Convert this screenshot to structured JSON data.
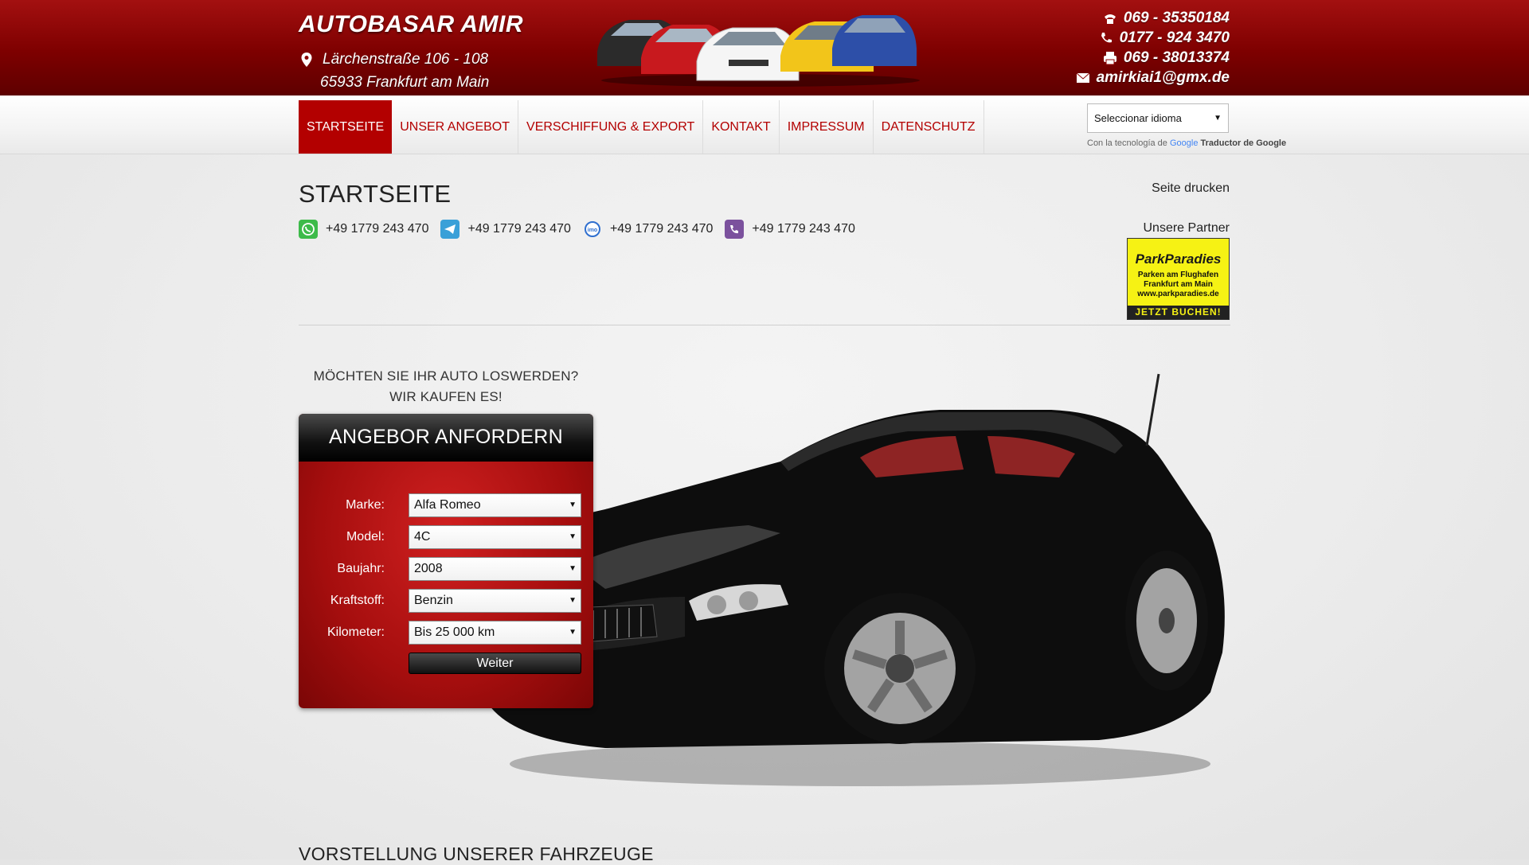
{
  "header": {
    "brand": "AUTOBASAR AMIR",
    "address_line1": "Lärchenstraße 106 - 108",
    "address_line2": "65933 Frankfurt am Main",
    "contacts": [
      {
        "icon": "phone-icon",
        "text": "069 - 35350184"
      },
      {
        "icon": "mobile-icon",
        "text": "0177 - 924 3470"
      },
      {
        "icon": "fax-icon",
        "text": "069 - 38013374"
      },
      {
        "icon": "email-icon",
        "text": "amirkiai1@gmx.de"
      }
    ]
  },
  "nav": {
    "items": [
      "STARTSEITE",
      "UNSER ANGEBOT",
      "VERSCHIFFUNG & EXPORT",
      "KONTAKT",
      "IMPRESSUM",
      "DATENSCHUTZ"
    ],
    "active_index": 0
  },
  "translate": {
    "select_label": "Seleccionar idioma",
    "powered_prefix": "Con la tecnología de",
    "powered_google": "Google",
    "powered_suffix": "Traductor de Google"
  },
  "page": {
    "title": "STARTSEITE",
    "print": "Seite drucken",
    "partner_label": "Unsere Partner",
    "partner": {
      "logo": "ParkParadies",
      "line1": "Parken am Flughafen",
      "line2": "Frankfurt am Main",
      "line3": "www.parkparadies.de",
      "cta": "JETZT BUCHEN!"
    },
    "phones": [
      {
        "icon": "whatsapp-icon",
        "text": "+49 1779 243 470"
      },
      {
        "icon": "telegram-icon",
        "text": "+49 1779 243 470"
      },
      {
        "icon": "imo-icon",
        "text": "+49 1779 243 470"
      },
      {
        "icon": "viber-icon",
        "text": "+49 1779 243 470"
      }
    ],
    "question_line1": "MÖCHTEN SIE IHR AUTO LOSWERDEN?",
    "question_line2": "WIR KAUFEN ES!",
    "bottom_title": "VORSTELLUNG UNSERER FAHRZEUGE"
  },
  "form": {
    "title": "ANGEBOR ANFORDERN",
    "fields": [
      {
        "label": "Marke:",
        "value": "Alfa Romeo"
      },
      {
        "label": "Model:",
        "value": "4C"
      },
      {
        "label": "Baujahr:",
        "value": "2008"
      },
      {
        "label": "Kraftstoff:",
        "value": "Benzin"
      },
      {
        "label": "Kilometer:",
        "value": "Bis 25 000 km"
      }
    ],
    "submit": "Weiter"
  },
  "colors": {
    "header_red": "#8b0000",
    "nav_text": "#b30000",
    "nav_active_bg": "#b30000"
  }
}
